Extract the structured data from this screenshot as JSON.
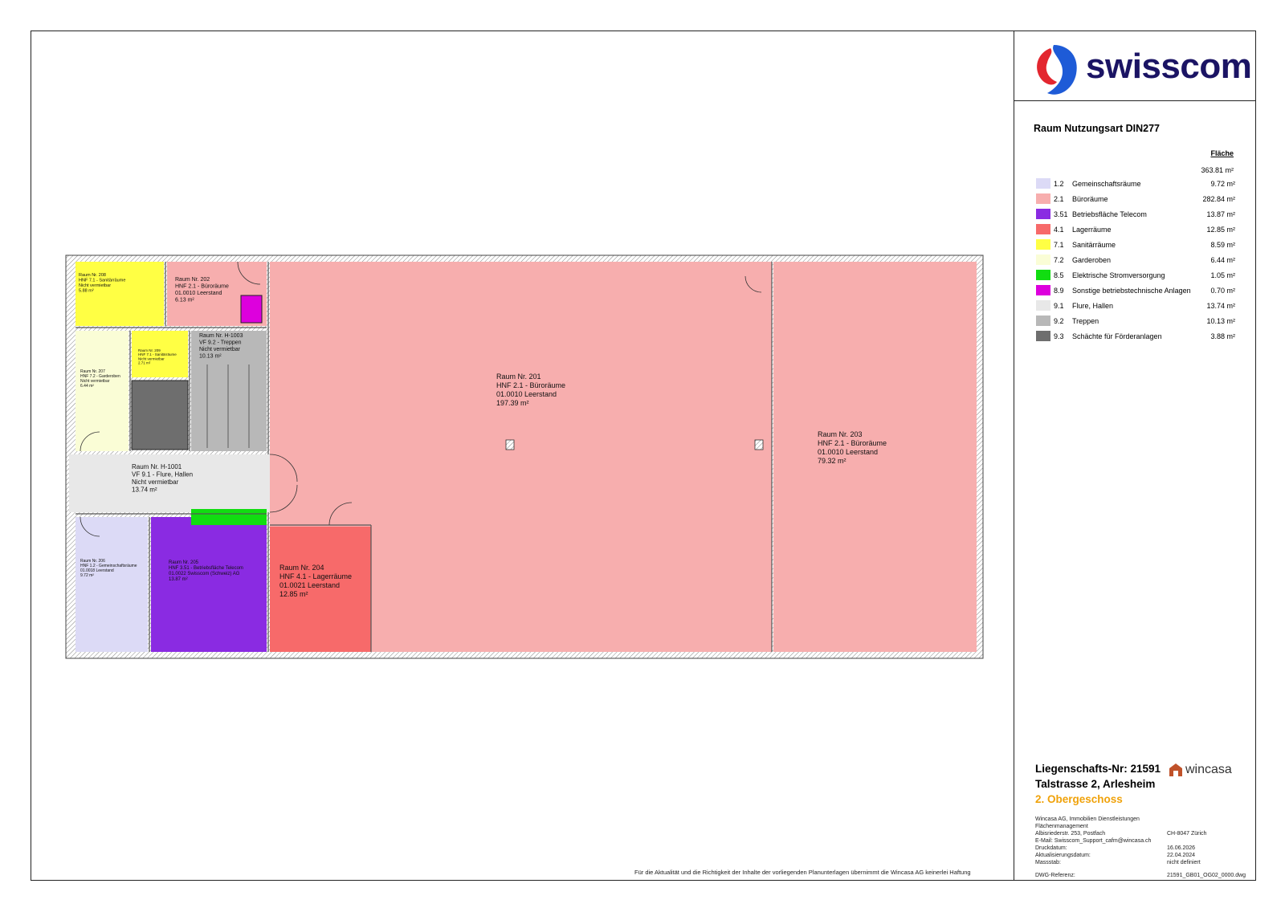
{
  "logo": {
    "brand": "swisscom"
  },
  "legend": {
    "title": "Raum Nutzungsart DIN277",
    "column_header": "Fläche",
    "total": "363.81 m²",
    "items": [
      {
        "code": "1.2",
        "name": "Gemeinschaftsräume",
        "area": "9.72 m²",
        "color": "#dcdaf6"
      },
      {
        "code": "2.1",
        "name": "Büroräume",
        "area": "282.84 m²",
        "color": "#f7aeae"
      },
      {
        "code": "3.51",
        "name": "Betriebsfläche Telecom",
        "area": "13.87 m²",
        "color": "#8a2be2"
      },
      {
        "code": "4.1",
        "name": "Lagerräume",
        "area": "12.85 m²",
        "color": "#f76a6a"
      },
      {
        "code": "7.1",
        "name": "Sanitärräume",
        "area": "8.59 m²",
        "color": "#ffff44"
      },
      {
        "code": "7.2",
        "name": "Garderoben",
        "area": "6.44 m²",
        "color": "#fafdd6"
      },
      {
        "code": "8.5",
        "name": "Elektrische Stromversorgung",
        "area": "1.05 m²",
        "color": "#11dd11"
      },
      {
        "code": "8.9",
        "name": "Sonstige betriebstechnische Anlagen",
        "area": "0.70 m²",
        "color": "#dd00dd"
      },
      {
        "code": "9.1",
        "name": "Flure, Hallen",
        "area": "13.74 m²",
        "color": "#e8e8e8"
      },
      {
        "code": "9.2",
        "name": "Treppen",
        "area": "10.13 m²",
        "color": "#b8b8b8"
      },
      {
        "code": "9.3",
        "name": "Schächte für Förderanlagen",
        "area": "3.88 m²",
        "color": "#6e6e6e"
      }
    ]
  },
  "property": {
    "number": "Liegenschafts-Nr: 21591",
    "address": "Talstrasse 2, Arlesheim",
    "floor": "2. Obergeschoss",
    "manager_logo": "wincasa"
  },
  "info": {
    "company": "Wincasa AG, Immobilien Dienstleistungen",
    "department": "Flächenmanagement",
    "street": "Albisriederstr. 253, Postfach",
    "city": "CH-8047 Zürich",
    "email": "E-Mail: Swisscom_Support_cafm@wincasa.ch",
    "print_label": "Druckdatum:",
    "print_date": "16.06.2026",
    "update_label": "Aktualisierungsdatum:",
    "update_date": "22.04.2024",
    "scale_label": "Massstab:",
    "scale_value": "nicht definiert",
    "dwg_label": "DWG-Referenz:",
    "dwg_value": "21591_GB01_OG02_0000.dwg"
  },
  "disclaimer": "Für die Aktualität und die Richtigkeit der Inhalte der vorliegenden Planunterlagen übernimmt die Wincasa AG keinerlei Haftung",
  "rooms": [
    {
      "id": "r201",
      "lines": [
        "Raum Nr. 201",
        "HNF 2.1 - Büroräume",
        "01.0010 Leerstand",
        "197.39 m²"
      ],
      "color": "#f7aeae"
    },
    {
      "id": "r202",
      "lines": [
        "Raum Nr. 202",
        "HNF 2.1 - Büroräume",
        "01.0010 Leerstand",
        "6.13 m²"
      ],
      "color": "#f7aeae"
    },
    {
      "id": "r203",
      "lines": [
        "Raum Nr. 203",
        "HNF 2.1 - Büroräume",
        "01.0010 Leerstand",
        "79.32 m²"
      ],
      "color": "#f7aeae"
    },
    {
      "id": "r204",
      "lines": [
        "Raum Nr. 204",
        "HNF 4.1 - Lagerräume",
        "01.0021 Leerstand",
        "12.85 m²"
      ],
      "color": "#f76a6a"
    },
    {
      "id": "r205",
      "lines": [
        "Raum Nr. 205",
        "HNF 3.51 - Betriebsfläche Telecom",
        "01.0022 Swisscom (Schweiz) AG",
        "13.87 m²"
      ],
      "color": "#8a2be2"
    },
    {
      "id": "r206",
      "lines": [
        "Raum Nr. 206",
        "HNF 1.2 - Gemeinschaftsräume",
        "01.0018 Leerstand",
        "9.72 m²"
      ],
      "color": "#dcdaf6"
    },
    {
      "id": "r207",
      "lines": [
        "Raum Nr. 207",
        "HNF 7.2 - Garderoben",
        "Nicht vermietbar",
        "6.44 m²"
      ],
      "color": "#fafdd6"
    },
    {
      "id": "r208",
      "lines": [
        "Raum Nr. 208",
        "HNF 7.1 - Sanitärräume",
        "Nicht vermietbar",
        "5.88 m²"
      ],
      "color": "#ffff44"
    },
    {
      "id": "r209",
      "lines": [
        "Raum Nr. 209",
        "HNF 7.1 - Sanitärräume",
        "Nicht vermietbar",
        "2.71 m²"
      ],
      "color": "#ffff44"
    },
    {
      "id": "rH1001",
      "lines": [
        "Raum Nr. H-1001",
        "VF 9.1 - Flure, Hallen",
        "Nicht vermietbar",
        "13.74 m²"
      ],
      "color": "#e8e8e8"
    },
    {
      "id": "rH1003",
      "lines": [
        "Raum Nr. H-1003",
        "VF 9.2 - Treppen",
        "Nicht vermietbar",
        "10.13 m²"
      ],
      "color": "#b8b8b8"
    }
  ]
}
